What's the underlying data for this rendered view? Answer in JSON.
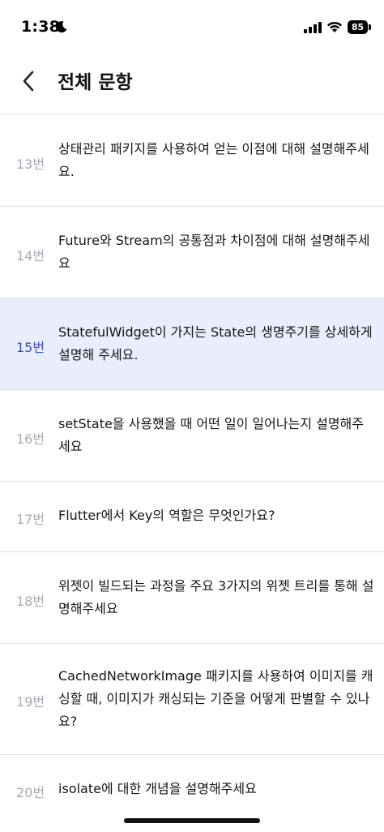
{
  "status_bar": {
    "time": "1:38",
    "battery": "85"
  },
  "header": {
    "title": "전체 문항"
  },
  "questions": [
    {
      "number": "13번",
      "text": "상태관리 패키지를 사용하여 얻는 이점에 대해 설명해주세요.",
      "active": false
    },
    {
      "number": "14번",
      "text": "Future와 Stream의 공통점과 차이점에 대해 설명해주세요",
      "active": false
    },
    {
      "number": "15번",
      "text": "StatefulWidget이 가지는 State의 생명주기를 상세하게 설명해 주세요.",
      "active": true
    },
    {
      "number": "16번",
      "text": "setState을 사용했을 때 어떤 일이 일어나는지 설명해주세요",
      "active": false
    },
    {
      "number": "17번",
      "text": "Flutter에서 Key의 역할은 무엇인가요?",
      "active": false
    },
    {
      "number": "18번",
      "text": "위젯이 빌드되는 과정을 주요 3가지의 위젯 트리를 통해 설명해주세요",
      "active": false
    },
    {
      "number": "19번",
      "text": "CachedNetworkImage 패키지를 사용하여 이미지를 캐싱할 때, 이미지가 캐싱되는 기준을 어떻게 판별할 수 있나요?",
      "active": false
    },
    {
      "number": "20번",
      "text": "isolate에 대한 개념을 설명해주세요",
      "active": false
    }
  ]
}
